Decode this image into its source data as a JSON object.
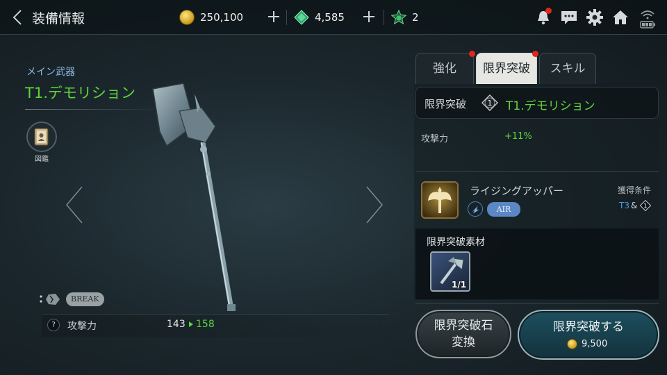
{
  "header": {
    "title": "装備情報",
    "gold": "250,100",
    "gems": "4,585",
    "tokens": "2"
  },
  "weapon": {
    "category": "メイン武器",
    "name": "T1.デモリション",
    "codex_label": "図鑑",
    "break_badge": "BREAK",
    "stat_label": "攻撃力",
    "stat_old": "143",
    "stat_new": "158"
  },
  "tabs": [
    {
      "label": "強化",
      "notify": true
    },
    {
      "label": "限界突破",
      "notify": true,
      "active": true
    },
    {
      "label": "スキル",
      "notify": false
    }
  ],
  "limit_break": {
    "label": "限界突破",
    "level": "1",
    "name": "T1.デモリション",
    "attack_label": "攻撃力",
    "attack_bonus": "+11%"
  },
  "skill": {
    "name": "ライジングアッパー",
    "tag": "AIR",
    "condition_label": "獲得条件",
    "condition_tier": "T3",
    "condition_amp": "&",
    "condition_level": "1"
  },
  "materials": {
    "title": "限界突破素材",
    "count": "1/1"
  },
  "buttons": {
    "convert_line1": "限界突破石",
    "convert_line2": "変換",
    "break_label": "限界突破する",
    "break_cost": "9,500"
  },
  "icons": [
    "back-icon",
    "gold-coin-icon",
    "gem-icon",
    "token-icon",
    "plus-icon",
    "bell-icon",
    "chat-icon",
    "gear-icon",
    "home-icon",
    "wifi-battery-icon",
    "codex-icon",
    "break-icon",
    "help-icon",
    "skill-axe-icon",
    "air-skill-icon",
    "material-axe-icon"
  ],
  "colors": {
    "accent_green": "#5fd33c",
    "tag_blue": "#5b88c4",
    "notify_red": "#e0261d",
    "tab_active": "#e6e7e3"
  }
}
